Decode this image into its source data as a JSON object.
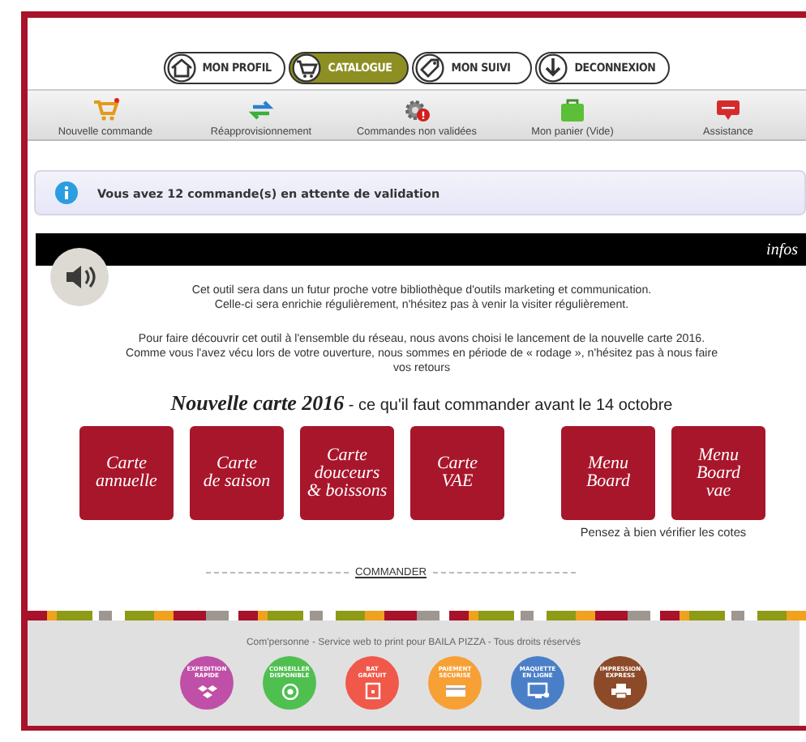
{
  "nav_tabs": [
    {
      "label": "MON PROFIL",
      "selected": false
    },
    {
      "label": "CATALOGUE",
      "selected": true
    },
    {
      "label": "MON SUIVI",
      "selected": false
    },
    {
      "label": "DECONNEXION",
      "selected": false
    }
  ],
  "toolbar": [
    {
      "label": "Nouvelle commande"
    },
    {
      "label": "Réapprovisionnement"
    },
    {
      "label": "Commandes non validées"
    },
    {
      "label": "Mon panier (Vide)"
    },
    {
      "label": "Assistance"
    }
  ],
  "alert": {
    "text": "Vous avez 12 commande(s) en attente de validation"
  },
  "infos_bar": {
    "title": "infos"
  },
  "paragraphs": [
    [
      "Cet outil sera dans un futur proche votre bibliothèque d'outils marketing et communication.",
      "Celle-ci sera enrichie régulièrement, n'hésitez pas à venir la visiter régulièrement."
    ],
    [
      "Pour faire découvrir cet outil à l'ensemble du réseau, nous avons choisi le lancement de la nouvelle carte 2016.",
      "Comme vous l'avez vécu lors de votre ouverture, nous sommes en période de « rodage », n'hésitez pas à nous faire",
      "vos retours"
    ]
  ],
  "headline": "**Nouvelle carte 2016** - ce qu'il faut commander avant le 14 octobre",
  "tile_groups": [
    {
      "tiles": [
        {
          "lines": [
            "Carte",
            "annuelle"
          ]
        },
        {
          "lines": [
            "Carte",
            "de saison"
          ]
        },
        {
          "lines": [
            "Carte",
            "douceurs",
            "& boissons"
          ]
        },
        {
          "lines": [
            "Carte",
            "VAE"
          ]
        }
      ]
    },
    {
      "tiles": [
        {
          "lines": [
            "Menu",
            "Board"
          ]
        },
        {
          "lines": [
            "Menu",
            "Board",
            "vae"
          ]
        }
      ],
      "note": "Pensez à bien vérifier les cotes"
    }
  ],
  "order_link": "COMMANDER",
  "footer": {
    "copyright": "Com'personne - Service web to print pour BAILA PIZZA - Tous droits réservés",
    "badges": [
      {
        "lines": [
          "EXPEDITION",
          "RAPIDE"
        ],
        "color": "#c04fa8"
      },
      {
        "lines": [
          "CONSEILLER",
          "DISPONIBLE"
        ],
        "color": "#4fbf4f"
      },
      {
        "lines": [
          "BAT",
          "GRATUIT"
        ],
        "color": "#f0584a"
      },
      {
        "lines": [
          "PAIEMENT",
          "SECURISE"
        ],
        "color": "#f7a035"
      },
      {
        "lines": [
          "MAQUETTE",
          "EN LIGNE"
        ],
        "color": "#4a7fc8"
      },
      {
        "lines": [
          "IMPRESSION",
          "EXPRESS"
        ],
        "color": "#8c4a28"
      }
    ]
  }
}
